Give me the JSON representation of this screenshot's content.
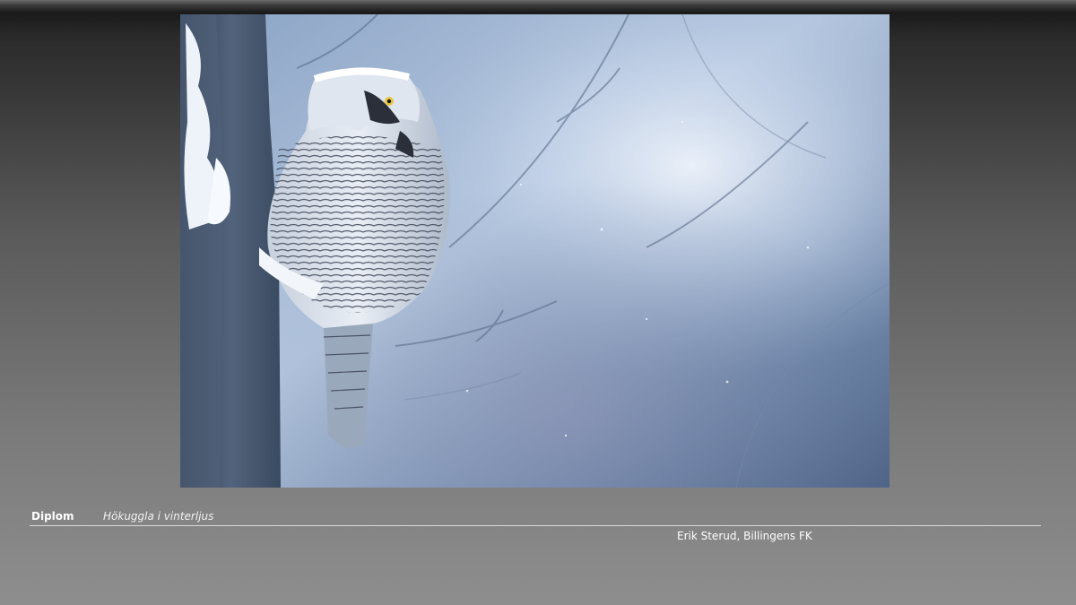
{
  "photo": {
    "subject": "owl-in-snowy-forest"
  },
  "caption": {
    "award": "Diplom",
    "title": "Hökuggla i vinterljus",
    "author": "Erik Sterud, Billingens FK"
  },
  "colors": {
    "background_top": "#111111",
    "background_bottom": "#8e8e8e",
    "divider": "#d9d9d9",
    "text": "#ffffff"
  }
}
